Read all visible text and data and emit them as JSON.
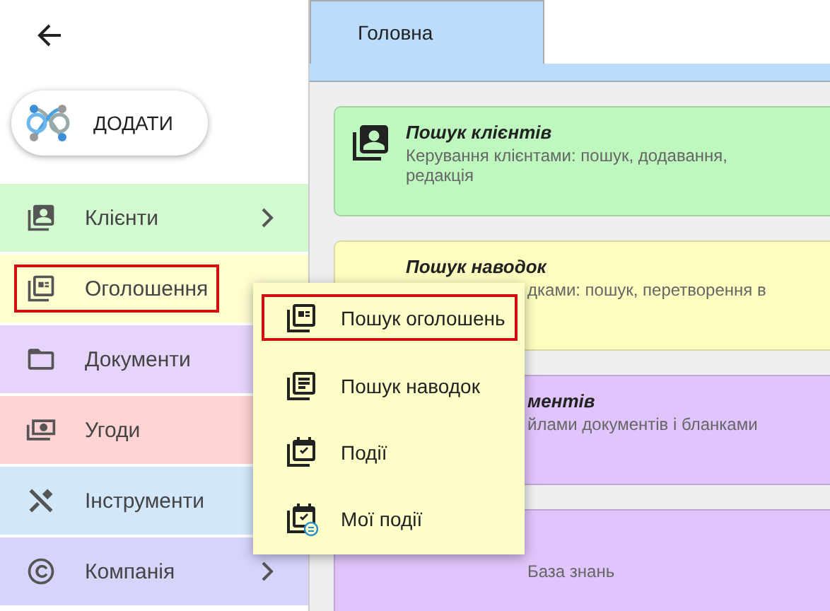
{
  "add_button": {
    "label": "ДОДАТИ"
  },
  "sidebar": {
    "items": [
      {
        "label": "Клієнти",
        "chevron": true,
        "highlighted": false,
        "color": "#d3f9d0"
      },
      {
        "label": "Оголошення",
        "chevron": false,
        "highlighted": true,
        "color": "#fefed0"
      },
      {
        "label": "Документи",
        "highlighted": false,
        "color": "#e6d4fb"
      },
      {
        "label": "Угоди",
        "highlighted": false,
        "color": "#fed3d3"
      },
      {
        "label": "Інструменти",
        "highlighted": false,
        "color": "#d3e7fb"
      },
      {
        "label": "Компанія",
        "chevron": true,
        "highlighted": false,
        "color": "#d6d4fb"
      }
    ]
  },
  "tabs": [
    {
      "label": "Головна",
      "selected": true
    }
  ],
  "cards": [
    {
      "color": "#bff8bf",
      "lines": [
        {
          "kind": "title",
          "text": "Пошук клієнтів"
        },
        {
          "kind": "desc",
          "text": "Керування клієнтами: пошук, додавання, редакція"
        }
      ]
    },
    {
      "color": "#fefec0",
      "lines": [
        {
          "kind": "title",
          "text": "Пошук наводок"
        },
        {
          "kind": "desc-fragment",
          "text": "дками: пошук, перетворення в"
        }
      ]
    },
    {
      "color": "#e0c4fc",
      "lines": [
        {
          "kind": "title-fragment",
          "text": "ментів"
        },
        {
          "kind": "desc-fragment",
          "text": "йлами документів і бланками"
        }
      ]
    },
    {
      "color": "#e0c4fc",
      "lines": [
        {
          "kind": "desc-fragment",
          "text": "База знань"
        }
      ]
    }
  ],
  "submenu": {
    "items": [
      {
        "label": "Пошук оголошень",
        "highlighted": true
      },
      {
        "label": "Пошук наводок",
        "highlighted": false
      },
      {
        "label": "Події",
        "highlighted": false
      },
      {
        "label": "Мої події",
        "highlighted": false
      }
    ]
  }
}
